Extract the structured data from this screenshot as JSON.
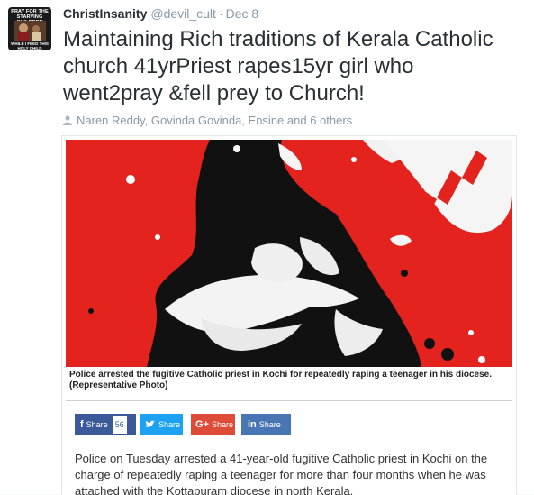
{
  "author": {
    "name": "ChristInsanity",
    "handle": "@devil_cult",
    "separator": "·",
    "date": "Dec 8",
    "avatar_top": "PRAY FOR THE STARVING CHILDREN",
    "avatar_bottom": "WHILE I FEED THIS HOLY CHILD"
  },
  "tweet": {
    "text": "Maintaining Rich traditions of Kerala Catholic church 41yrPriest rapes15yr girl who went2pray &fell prey to Church!",
    "retweeted_by": "Naren Reddy, Govinda Govinda, Ensine and 6 others"
  },
  "article": {
    "caption": "Police arrested the fugitive Catholic priest in Kochi for repeatedly raping a teenager in his diocese. (Representative Photo)",
    "share_buttons": [
      {
        "label": "Share",
        "icon": "f",
        "count": "56",
        "color": "#3b5998"
      },
      {
        "label": "Share",
        "icon": "twitter-bird",
        "color": "#1da1f2"
      },
      {
        "label": "Share",
        "icon": "G+",
        "color": "#dd4b39"
      },
      {
        "label": "Share",
        "icon": "in",
        "color": "#4875b4"
      }
    ],
    "body": "Police on Tuesday arrested a 41-year-old fugitive Catholic priest in Kochi on the charge of repeatedly raping a teenager for more than four months when he was attached with the Kottapuram diocese in north Kerala."
  },
  "colors": {
    "illustration_red": "#e4231e",
    "text_primary": "#292f33",
    "text_muted": "#8899a6"
  }
}
